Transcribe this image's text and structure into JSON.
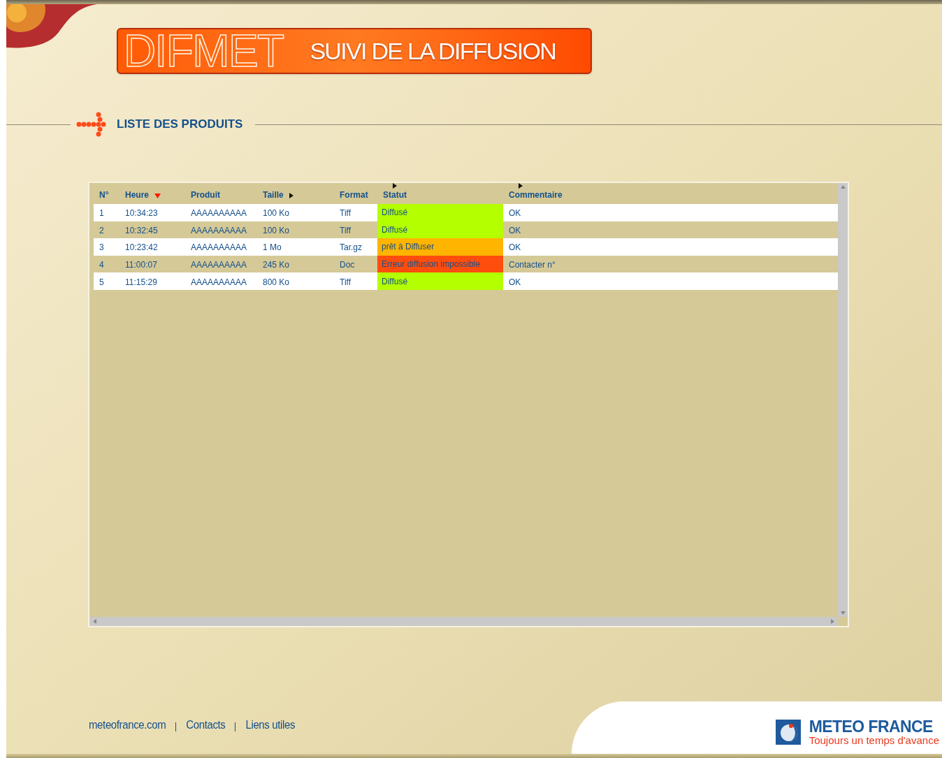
{
  "banner": {
    "logo": "DIFMET",
    "title": "SUIVI DE LA DIFFUSION"
  },
  "section": {
    "title": "LISTE DES PRODUITS"
  },
  "table": {
    "columns": [
      {
        "label": "N°",
        "kind": "plain"
      },
      {
        "label": "Heure",
        "kind": "sorted"
      },
      {
        "label": "Produit",
        "kind": "plain"
      },
      {
        "label": "Taille",
        "kind": "arrow"
      },
      {
        "label": "Format",
        "kind": "plain"
      },
      {
        "label": "Statut",
        "kind": "marker"
      },
      {
        "label": "Commentaire",
        "kind": "marker"
      }
    ],
    "rows": [
      {
        "cells": [
          "1",
          "10:34:23",
          "AAAAAAAAAA",
          "100 Ko",
          "Tiff",
          "Diffusé",
          "OK"
        ],
        "color": "#b4ff00"
      },
      {
        "cells": [
          "2",
          "10:32:45",
          "AAAAAAAAAA",
          "100 Ko",
          "Tiff",
          "Diffusé",
          "OK"
        ],
        "color": "#b4ff00"
      },
      {
        "cells": [
          "3",
          "10:23:42",
          "AAAAAAAAAA",
          "1 Mo",
          "Tar.gz",
          "prêt à Diffuser",
          "OK"
        ],
        "color": "#ffb400"
      },
      {
        "cells": [
          "4",
          "11:00:07",
          "AAAAAAAAAA",
          "245 Ko",
          "Doc",
          "Erreur diffusion impossible",
          "Contacter n°"
        ],
        "color": "#ff4d0d"
      },
      {
        "cells": [
          "5",
          "11:15:29",
          "AAAAAAAAAA",
          "800 Ko",
          "Tiff",
          "Diffusé",
          "OK"
        ],
        "color": "#b4ff00"
      }
    ]
  },
  "footer": {
    "links": [
      "meteofrance.com",
      "Contacts",
      "Liens utiles"
    ],
    "brand": "METEO FRANCE",
    "tagline": "Toujours un temps d'avance"
  }
}
